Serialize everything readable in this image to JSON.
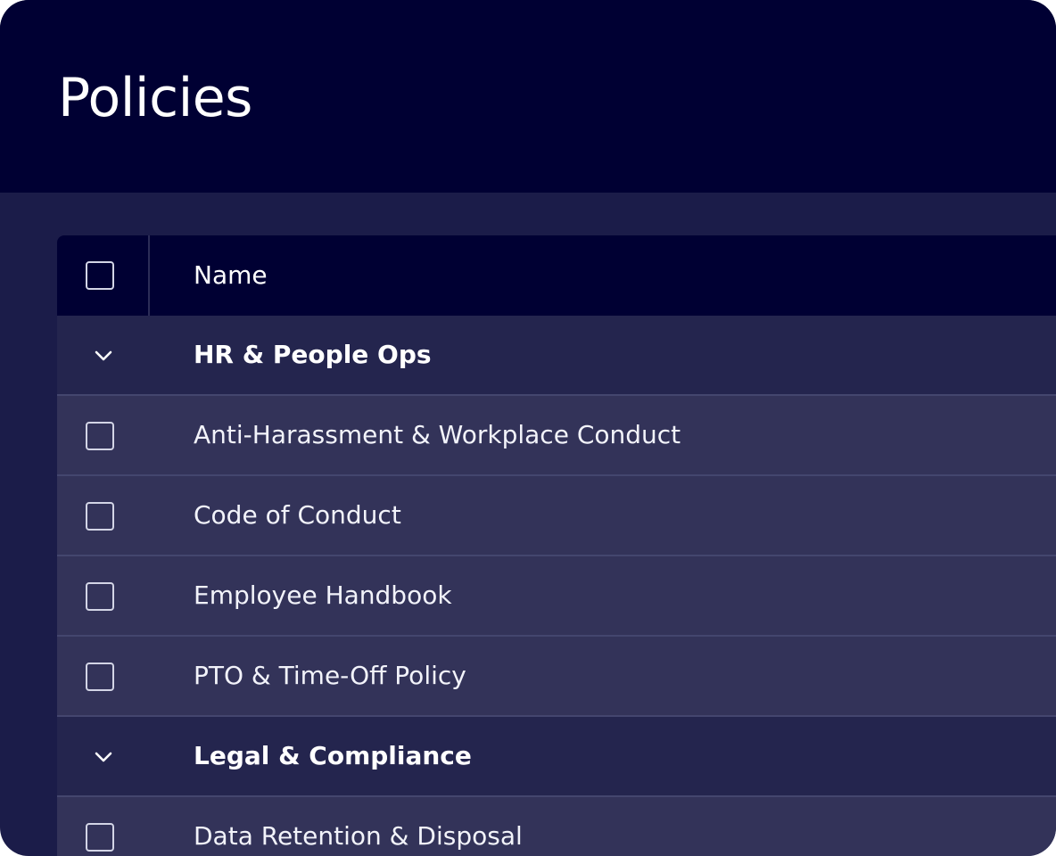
{
  "page": {
    "title": "Policies"
  },
  "table": {
    "columns": [
      {
        "label": "Name"
      }
    ],
    "groups": [
      {
        "name": "HR & People Ops",
        "expanded": true,
        "items": [
          "Anti-Harassment & Workplace Conduct",
          "Code of Conduct",
          "Employee Handbook",
          "PTO & Time-Off Policy"
        ]
      },
      {
        "name": "Legal & Compliance",
        "expanded": true,
        "items": [
          "Data Retention & Disposal"
        ]
      }
    ]
  },
  "icons": {
    "group_toggle": "chevron-down-icon",
    "row_select": "checkbox-unchecked"
  },
  "colors": {
    "header_bg": "#000033",
    "page_bg": "#1b1c49",
    "group_row_bg": "#24254e",
    "item_row_bg": "#333359",
    "text": "#ffffff"
  }
}
